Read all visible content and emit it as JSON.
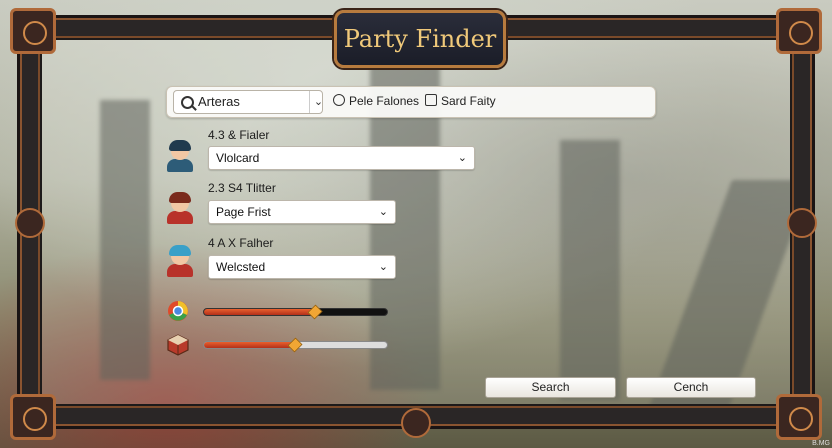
{
  "app": {
    "title": "Party Finder"
  },
  "toolbar": {
    "search_value": "Arteras",
    "filter1_label": "Pele Falones",
    "filter2_label": "Sard Faity"
  },
  "rows": [
    {
      "label": "4.3 & Fialer",
      "value": "Vlolcard",
      "avatar": "male-blue-hair"
    },
    {
      "label": "2.3 S4 Tlitter",
      "value": "Page Frist",
      "avatar": "red-hair-warrior"
    },
    {
      "label": "4 A X Falher",
      "value": "Welcsted",
      "avatar": "blue-hair-red-armor"
    }
  ],
  "sliders": [
    {
      "icon": "browser-icon",
      "fill": 0.6
    },
    {
      "icon": "cube-icon",
      "fill": 0.49
    }
  ],
  "buttons": {
    "search": "Search",
    "cancel": "Cench"
  },
  "colors": {
    "accent_gold": "#f0c97a",
    "frame_copper": "#b06a3a",
    "slider_fill": "#e8602e"
  },
  "watermark": "B.MG"
}
